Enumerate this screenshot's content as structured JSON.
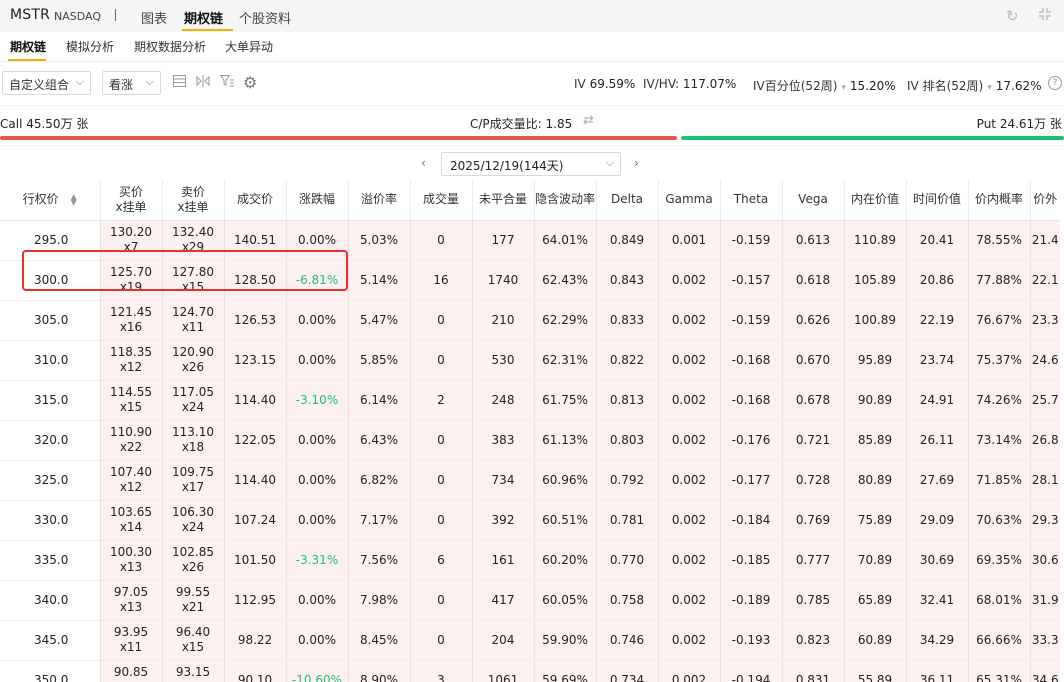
{
  "header": {
    "symbol": "MSTR",
    "exchange": "NASDAQ",
    "tabs": [
      {
        "label": "图表",
        "active": false
      },
      {
        "label": "期权链",
        "active": true
      },
      {
        "label": "个股资料",
        "active": false
      }
    ],
    "icons": [
      "refresh-icon",
      "collapse-icon"
    ],
    "accent_color": "#f0b400"
  },
  "subtabs": [
    {
      "label": "期权链",
      "active": true
    },
    {
      "label": "模拟分析",
      "active": false
    },
    {
      "label": "期权数据分析",
      "active": false
    },
    {
      "label": "大单异动",
      "active": false
    }
  ],
  "toolbar": {
    "combo_select": "自定义组合",
    "direction_select": "看涨",
    "iv_label": "IV",
    "iv_value": "69.59%",
    "ivhv_label": "IV/HV:",
    "ivhv_value": "117.07%",
    "iv_pct_label": "IV百分位(52周)",
    "iv_pct_value": "15.20%",
    "iv_rank_label": "IV 排名(52周)",
    "iv_rank_value": "17.62%",
    "help": "?"
  },
  "cp": {
    "call_label": "Call 45.50万 张",
    "ratio_label": "C/P成交量比: 1.85",
    "put_label": "Put 24.61万 张",
    "call_color": "#e2574c",
    "put_color": "#1fbf75",
    "call_share": 0.64
  },
  "expiry": {
    "selected": "2025/12/19(144天)"
  },
  "table": {
    "columns": [
      "行权价",
      "买价\nx挂单",
      "卖价\nx挂单",
      "成交价",
      "涨跌幅",
      "溢价率",
      "成交量",
      "未平合量",
      "隐含波动率",
      "Delta",
      "Gamma",
      "Theta",
      "Vega",
      "内在价值",
      "时间价值",
      "价内概率",
      "价外"
    ],
    "highlight_color": "#e5332a",
    "down_color": "#1fbf75",
    "rows": [
      {
        "strike": "295.0",
        "bid": "130.20",
        "bid_size": "x7",
        "ask": "132.40",
        "ask_size": "x29",
        "last": "140.51",
        "chg": "0.00%",
        "premium": "5.03%",
        "vol": "0",
        "oi": "177",
        "iv": "64.01%",
        "delta": "0.849",
        "gamma": "0.001",
        "theta": "-0.159",
        "vega": "0.613",
        "intrinsic": "110.89",
        "time_value": "20.41",
        "itm_prob": "78.55%",
        "otm": "21.4"
      },
      {
        "strike": "300.0",
        "bid": "125.70",
        "bid_size": "x19",
        "ask": "127.80",
        "ask_size": "x15",
        "last": "128.50",
        "chg": "-6.81%",
        "premium": "5.14%",
        "vol": "16",
        "oi": "1740",
        "iv": "62.43%",
        "delta": "0.843",
        "gamma": "0.002",
        "theta": "-0.157",
        "vega": "0.618",
        "intrinsic": "105.89",
        "time_value": "20.86",
        "itm_prob": "77.88%",
        "otm": "22.1"
      },
      {
        "strike": "305.0",
        "bid": "121.45",
        "bid_size": "x16",
        "ask": "124.70",
        "ask_size": "x11",
        "last": "126.53",
        "chg": "0.00%",
        "premium": "5.47%",
        "vol": "0",
        "oi": "210",
        "iv": "62.29%",
        "delta": "0.833",
        "gamma": "0.002",
        "theta": "-0.159",
        "vega": "0.626",
        "intrinsic": "100.89",
        "time_value": "22.19",
        "itm_prob": "76.67%",
        "otm": "23.3"
      },
      {
        "strike": "310.0",
        "bid": "118.35",
        "bid_size": "x12",
        "ask": "120.90",
        "ask_size": "x26",
        "last": "123.15",
        "chg": "0.00%",
        "premium": "5.85%",
        "vol": "0",
        "oi": "530",
        "iv": "62.31%",
        "delta": "0.822",
        "gamma": "0.002",
        "theta": "-0.168",
        "vega": "0.670",
        "intrinsic": "95.89",
        "time_value": "23.74",
        "itm_prob": "75.37%",
        "otm": "24.6"
      },
      {
        "strike": "315.0",
        "bid": "114.55",
        "bid_size": "x15",
        "ask": "117.05",
        "ask_size": "x24",
        "last": "114.40",
        "chg": "-3.10%",
        "premium": "6.14%",
        "vol": "2",
        "oi": "248",
        "iv": "61.75%",
        "delta": "0.813",
        "gamma": "0.002",
        "theta": "-0.168",
        "vega": "0.678",
        "intrinsic": "90.89",
        "time_value": "24.91",
        "itm_prob": "74.26%",
        "otm": "25.7"
      },
      {
        "strike": "320.0",
        "bid": "110.90",
        "bid_size": "x22",
        "ask": "113.10",
        "ask_size": "x18",
        "last": "122.05",
        "chg": "0.00%",
        "premium": "6.43%",
        "vol": "0",
        "oi": "383",
        "iv": "61.13%",
        "delta": "0.803",
        "gamma": "0.002",
        "theta": "-0.176",
        "vega": "0.721",
        "intrinsic": "85.89",
        "time_value": "26.11",
        "itm_prob": "73.14%",
        "otm": "26.8"
      },
      {
        "strike": "325.0",
        "bid": "107.40",
        "bid_size": "x12",
        "ask": "109.75",
        "ask_size": "x17",
        "last": "114.40",
        "chg": "0.00%",
        "premium": "6.82%",
        "vol": "0",
        "oi": "734",
        "iv": "60.96%",
        "delta": "0.792",
        "gamma": "0.002",
        "theta": "-0.177",
        "vega": "0.728",
        "intrinsic": "80.89",
        "time_value": "27.69",
        "itm_prob": "71.85%",
        "otm": "28.1"
      },
      {
        "strike": "330.0",
        "bid": "103.65",
        "bid_size": "x14",
        "ask": "106.30",
        "ask_size": "x24",
        "last": "107.24",
        "chg": "0.00%",
        "premium": "7.17%",
        "vol": "0",
        "oi": "392",
        "iv": "60.51%",
        "delta": "0.781",
        "gamma": "0.002",
        "theta": "-0.184",
        "vega": "0.769",
        "intrinsic": "75.89",
        "time_value": "29.09",
        "itm_prob": "70.63%",
        "otm": "29.3"
      },
      {
        "strike": "335.0",
        "bid": "100.30",
        "bid_size": "x13",
        "ask": "102.85",
        "ask_size": "x26",
        "last": "101.50",
        "chg": "-3.31%",
        "premium": "7.56%",
        "vol": "6",
        "oi": "161",
        "iv": "60.20%",
        "delta": "0.770",
        "gamma": "0.002",
        "theta": "-0.185",
        "vega": "0.777",
        "intrinsic": "70.89",
        "time_value": "30.69",
        "itm_prob": "69.35%",
        "otm": "30.6"
      },
      {
        "strike": "340.0",
        "bid": "97.05",
        "bid_size": "x13",
        "ask": "99.55",
        "ask_size": "x21",
        "last": "112.95",
        "chg": "0.00%",
        "premium": "7.98%",
        "vol": "0",
        "oi": "417",
        "iv": "60.05%",
        "delta": "0.758",
        "gamma": "0.002",
        "theta": "-0.189",
        "vega": "0.785",
        "intrinsic": "65.89",
        "time_value": "32.41",
        "itm_prob": "68.01%",
        "otm": "31.9"
      },
      {
        "strike": "345.0",
        "bid": "93.95",
        "bid_size": "x11",
        "ask": "96.40",
        "ask_size": "x15",
        "last": "98.22",
        "chg": "0.00%",
        "premium": "8.45%",
        "vol": "0",
        "oi": "204",
        "iv": "59.90%",
        "delta": "0.746",
        "gamma": "0.002",
        "theta": "-0.193",
        "vega": "0.823",
        "intrinsic": "60.89",
        "time_value": "34.29",
        "itm_prob": "66.66%",
        "otm": "33.3"
      },
      {
        "strike": "350.0",
        "bid": "90.85",
        "bid_size": "x10",
        "ask": "93.15",
        "ask_size": "x20",
        "last": "90.10",
        "chg": "-10.60%",
        "premium": "8.90%",
        "vol": "3",
        "oi": "1061",
        "iv": "59.69%",
        "delta": "0.734",
        "gamma": "0.002",
        "theta": "-0.194",
        "vega": "0.831",
        "intrinsic": "55.89",
        "time_value": "36.11",
        "itm_prob": "65.31%",
        "otm": "34.6"
      }
    ]
  }
}
